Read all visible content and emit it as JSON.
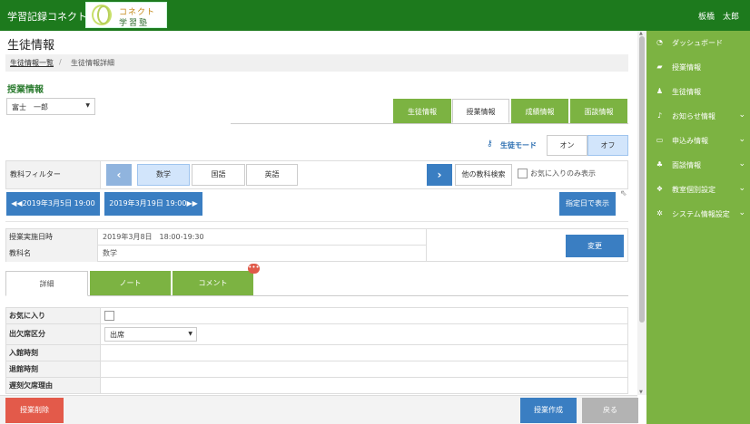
{
  "header": {
    "app_title": "学習記録コネクト",
    "logo_line1": "コネクト",
    "logo_line2": "学習塾",
    "user_name": "板橋　太郎"
  },
  "sidebar": {
    "items": [
      {
        "label": "ダッシュボード",
        "icon": "dashboard-icon",
        "has_submenu": false
      },
      {
        "label": "授業情報",
        "icon": "book-icon",
        "has_submenu": false
      },
      {
        "label": "生徒情報",
        "icon": "user-icon",
        "has_submenu": false
      },
      {
        "label": "お知らせ情報",
        "icon": "bell-icon",
        "has_submenu": true
      },
      {
        "label": "申込み情報",
        "icon": "card-icon",
        "has_submenu": true
      },
      {
        "label": "面談情報",
        "icon": "users-icon",
        "has_submenu": true
      },
      {
        "label": "教室個別設定",
        "icon": "cubes-icon",
        "has_submenu": true
      },
      {
        "label": "システム情報設定",
        "icon": "gear-icon",
        "has_submenu": true
      }
    ]
  },
  "page": {
    "title": "生徒情報",
    "breadcrumb": {
      "link": "生徒情報一覧",
      "sep": "/",
      "current": "生徒情報詳細"
    },
    "section_title": "授業情報",
    "student_select": {
      "value": "富士　一郎",
      "arrow": "▼"
    }
  },
  "tabs": [
    {
      "label": "生徒情報",
      "active": false
    },
    {
      "label": "授業情報",
      "active": true
    },
    {
      "label": "成績情報",
      "active": false
    },
    {
      "label": "面談情報",
      "active": false
    }
  ],
  "student_mode": {
    "label": "生徒モード",
    "on_label": "オン",
    "off_label": "オフ",
    "selected": "オフ"
  },
  "filter": {
    "label": "教科フィルター",
    "prev": "‹",
    "next": "›",
    "subjects": [
      {
        "label": "数学",
        "active": true
      },
      {
        "label": "国語",
        "active": false
      },
      {
        "label": "英語",
        "active": false
      }
    ],
    "other_search": "他の教科検索",
    "favorites_only": "お気に入りのみ表示"
  },
  "navigation": {
    "prev_lesson": "◀◀2019年3月5日 19:00",
    "next_lesson": "2019年3月19日 19:00▶▶",
    "date_display": "指定日で表示"
  },
  "lesson_info": {
    "rows": [
      {
        "key": "授業実施日時",
        "value": "2019年3月8日　18:00-19:30"
      },
      {
        "key": "教科名",
        "value": "数学"
      }
    ],
    "change_button": "変更"
  },
  "sub_tabs": [
    {
      "label": "詳細",
      "active": true
    },
    {
      "label": "ノート",
      "active": false
    },
    {
      "label": "コメント",
      "active": false
    }
  ],
  "comment_badge": "•••",
  "detail_rows": [
    {
      "key": "お気に入り",
      "type": "checkbox"
    },
    {
      "key": "出欠席区分",
      "type": "select",
      "value": "出席"
    },
    {
      "key": "入館時刻",
      "type": "text"
    },
    {
      "key": "退館時刻",
      "type": "text"
    },
    {
      "key": "遅刻欠席理由",
      "type": "text"
    }
  ],
  "footer": {
    "delete": "授業削除",
    "create": "授業作成",
    "back": "戻る"
  },
  "colors": {
    "header_green": "#1d7a1d",
    "sidebar_green": "#7cb342",
    "primary_blue": "#3a7ec2",
    "danger_red": "#e35a4a"
  }
}
